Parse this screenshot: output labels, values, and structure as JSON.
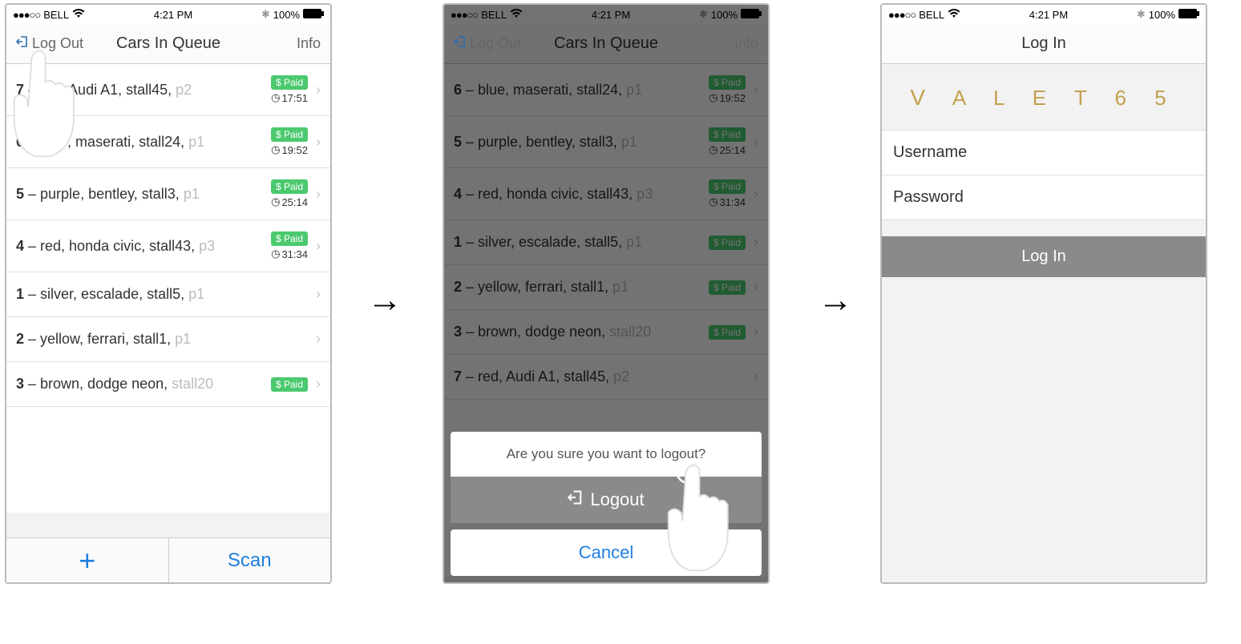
{
  "statusBar": {
    "carrier": "BELL",
    "time": "4:21 PM",
    "battery": "100%",
    "dotsPrefix": "●●●○○"
  },
  "screen1": {
    "nav": {
      "left": "Log Out",
      "title": "Cars In Queue",
      "right": "Info"
    },
    "rows": [
      {
        "num": "7",
        "text": " – red, Audi A1, stall45, ",
        "faded": "p2",
        "paid": true,
        "time": "17:51"
      },
      {
        "num": "6",
        "text": " – blue, maserati, stall24, ",
        "faded": "p1",
        "paid": true,
        "time": "19:52"
      },
      {
        "num": "5",
        "text": " – purple, bentley, stall3, ",
        "faded": "p1",
        "paid": true,
        "time": "25:14"
      },
      {
        "num": "4",
        "text": " – red, honda civic, stall43, ",
        "faded": "p3",
        "paid": true,
        "time": "31:34"
      },
      {
        "num": "1",
        "text": " – silver, escalade, stall5, ",
        "faded": "p1",
        "paid": false,
        "time": ""
      },
      {
        "num": "2",
        "text": " – yellow, ferrari, stall1, ",
        "faded": "p1",
        "paid": false,
        "time": ""
      },
      {
        "num": "3",
        "text": " – brown, dodge neon, ",
        "faded": "stall20",
        "paid": true,
        "time": ""
      }
    ],
    "paidLabel": "$ Paid",
    "toolbar": {
      "scan": "Scan"
    }
  },
  "screen2": {
    "nav": {
      "left": "Log Out",
      "title": "Cars In Queue",
      "right": "Info"
    },
    "rows": [
      {
        "num": "6",
        "text": " – blue, maserati, stall24, ",
        "faded": "p1",
        "paid": true,
        "time": "19:52"
      },
      {
        "num": "5",
        "text": " – purple, bentley, stall3, ",
        "faded": "p1",
        "paid": true,
        "time": "25:14"
      },
      {
        "num": "4",
        "text": " – red, honda civic, stall43, ",
        "faded": "p3",
        "paid": true,
        "time": "31:34"
      },
      {
        "num": "1",
        "text": " – silver, escalade, stall5, ",
        "faded": "p1",
        "paid": true,
        "time": ""
      },
      {
        "num": "2",
        "text": " – yellow, ferrari, stall1, ",
        "faded": "p1",
        "paid": true,
        "time": ""
      },
      {
        "num": "3",
        "text": " – brown, dodge neon, ",
        "faded": "stall20",
        "paid": true,
        "time": ""
      },
      {
        "num": "7",
        "text": " – red, Audi A1, stall45, ",
        "faded": "p2",
        "paid": false,
        "time": ""
      }
    ],
    "paidLabel": "$ Paid",
    "sheet": {
      "title": "Are you sure you want to logout?",
      "logout": "Logout",
      "cancel": "Cancel"
    }
  },
  "screen3": {
    "nav": {
      "title": "Log In"
    },
    "logo": "V A L E T 6 5",
    "fields": {
      "username": "Username",
      "password": "Password"
    },
    "loginBtn": "Log In"
  }
}
